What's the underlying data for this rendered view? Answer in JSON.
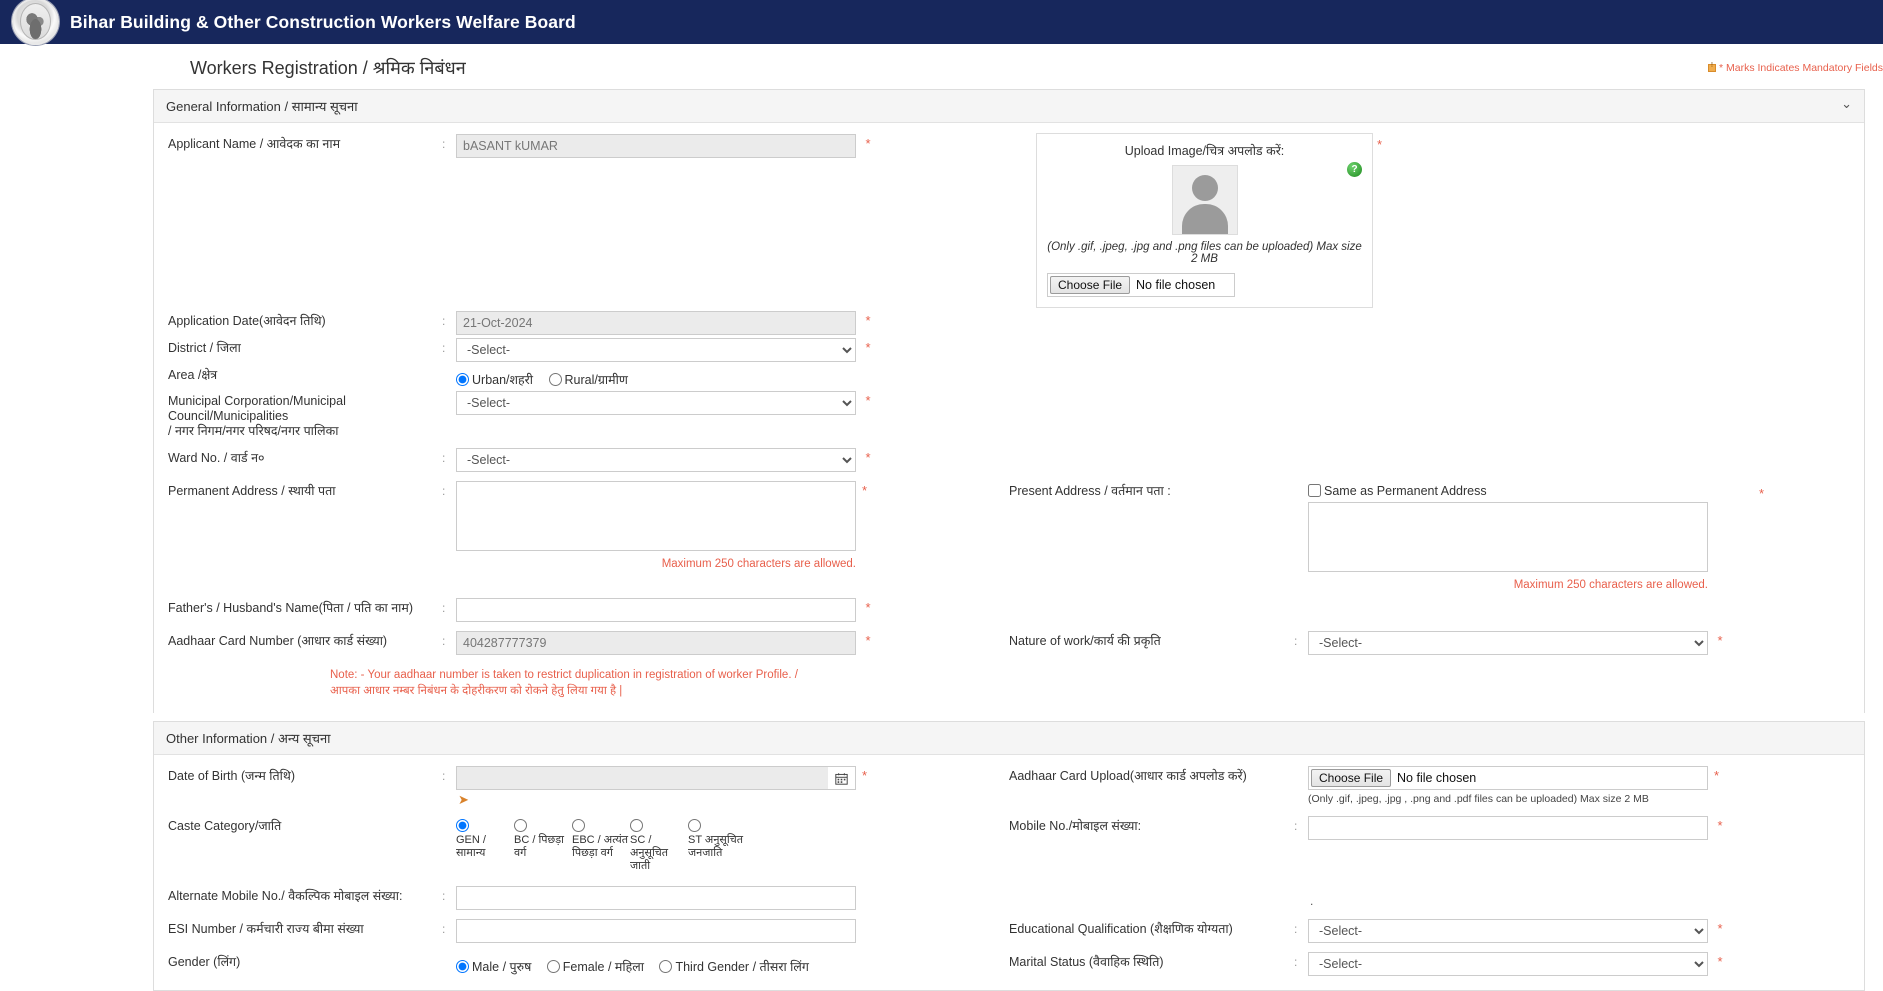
{
  "header": {
    "title": "Bihar Building & Other Construction Workers Welfare Board",
    "logo_name": "bihar-board-emblem"
  },
  "page": {
    "title": "Workers Registration / श्रमिक निबंधन",
    "mandatory_note": "* Marks Indicates Mandatory Fields"
  },
  "colors": {
    "header_bg": "#17275c",
    "required_red": "#e8604c",
    "panel_head_bg": "#f5f5f5",
    "readonly_bg": "#ebebeb"
  },
  "general": {
    "section_title": "General Information / सामान्य सूचना",
    "chevron": "⌄",
    "applicant_name": {
      "label": "Applicant Name / आवेदक का नाम",
      "value": "bASANT kUMAR",
      "required": "*"
    },
    "application_date": {
      "label": "Application Date(आवेदन तिथि)",
      "value": "21-Oct-2024",
      "required": "*"
    },
    "district": {
      "label": "District / जिला",
      "value": "-Select-",
      "required": "*"
    },
    "area": {
      "label": "Area /क्षेत्र",
      "options": [
        "Urban/शहरी",
        "Rural/ग्रामीण"
      ],
      "selected": "Urban/शहरी"
    },
    "municipal": {
      "label": "Municipal Corporation/Municipal Council/Municipalities",
      "label_hi": "/ नगर निगम/नगर परिषद/नगर पालिका",
      "value": "-Select-",
      "required": "*"
    },
    "ward": {
      "label": "Ward No. / वार्ड न०",
      "value": "-Select-",
      "required": "*"
    },
    "permanent_address": {
      "label": "Permanent Address / स्थायी पता",
      "value": "",
      "required": "*",
      "hint": "Maximum 250 characters are allowed."
    },
    "present_address": {
      "label": "Present Address / वर्तमान पता :",
      "value": "",
      "required": "*",
      "hint": "Maximum 250 characters are allowed.",
      "same_as_permanent": "Same as Permanent Address"
    },
    "father_name": {
      "label": "Father's / Husband's Name(पिता / पति का नाम)",
      "value": "",
      "required": "*"
    },
    "aadhaar_number": {
      "label": "Aadhaar Card Number (आधार कार्ड संख्या)",
      "value": "404287777379",
      "required": "*"
    },
    "nature_of_work": {
      "label": "Nature of work/कार्य की प्रकृति",
      "value": "-Select-",
      "required": "*"
    },
    "aadhaar_note_en": "Note: - Your aadhaar number is taken to restrict duplication in registration of worker Profile. /",
    "aadhaar_note_hi": "आपका आधार नम्बर निबंधन के दोहरीकरण को रोकने हेतु लिया गया है |",
    "upload_image": {
      "title": "Upload Image/चित्र अपलोड करें:",
      "hint": "(Only .gif, .jpeg, .jpg and .png files can be uploaded) Max size 2 MB",
      "choose_file_label": "Choose File",
      "file_status": "No file chosen",
      "required": "*",
      "help": "?"
    }
  },
  "other": {
    "section_title": "Other Information / अन्य सूचना",
    "date_of_birth": {
      "label": "Date of Birth (जन्म तिथि)",
      "value": "",
      "required": "*",
      "calendar_icon": "calendar-icon"
    },
    "caste_category": {
      "label": "Caste Category/जाति",
      "options": [
        "GEN / सामान्य",
        "BC / पिछड़ा वर्ग",
        "EBC / अत्यंत पिछड़ा वर्ग",
        "SC / अनुसूचित जाती",
        "ST अनुसूचित जनजाति"
      ],
      "selected": "GEN / सामान्य"
    },
    "alternate_mobile": {
      "label": "Alternate Mobile No./ वैकल्पिक मोबाइल संख्या:",
      "value": ""
    },
    "esi_number": {
      "label": "ESI Number / कर्मचारी राज्य बीमा संख्या",
      "value": ""
    },
    "gender": {
      "label": "Gender (लिंग)",
      "options": [
        "Male / पुरुष",
        "Female / महिला",
        "Third Gender / तीसरा लिंग"
      ],
      "selected": "Male / पुरुष"
    },
    "aadhaar_upload": {
      "label": "Aadhaar Card Upload(आधार कार्ड अपलोड करें)",
      "choose_file_label": "Choose File",
      "file_status": "No file chosen",
      "hint": "(Only .gif, .jpeg, .jpg , .png and .pdf files can be uploaded) Max size 2 MB",
      "required": "*"
    },
    "mobile_no": {
      "label": "Mobile No./मोबाइल संख्या:",
      "value": "",
      "required": "*"
    },
    "separator_dot": ".",
    "educational_qualification": {
      "label": "Educational Qualification (शैक्षणिक योग्यता)",
      "value": "-Select-",
      "required": "*"
    },
    "marital_status": {
      "label": "Marital Status (वैवाहिक स्थिति)",
      "value": "-Select-",
      "required": "*"
    }
  }
}
